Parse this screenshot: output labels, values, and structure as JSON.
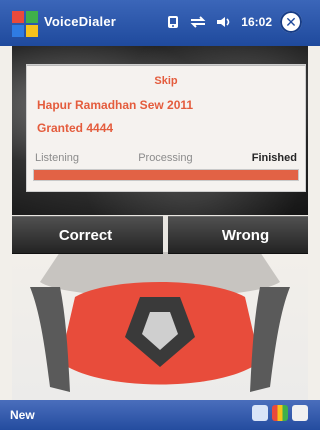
{
  "window": {
    "app_title": "VoiceDialer",
    "status": {
      "icons": [
        "pda-icon",
        "transfer-arrows-icon",
        "volume-icon"
      ],
      "time": "16:02"
    }
  },
  "dialog": {
    "line1": "Skip",
    "line2": "Hapur Ramadhan Sew 2011",
    "line3": "Granted 4444",
    "states": [
      "Listening",
      "Processing",
      "Finished"
    ],
    "active_state": "Finished",
    "progress": 1.0
  },
  "actions": {
    "correct": "Correct",
    "wrong": "Wrong"
  },
  "bottom": {
    "softkey_left": "New",
    "tray_icons": [
      "input-panel-icon",
      "color-grid-icon",
      "phone-icon"
    ]
  },
  "colors": {
    "titlebar": "#2c5bb0",
    "bottombar": "#2f57a7",
    "accent": "#e26245",
    "dark_button": "#2f2f2f"
  }
}
